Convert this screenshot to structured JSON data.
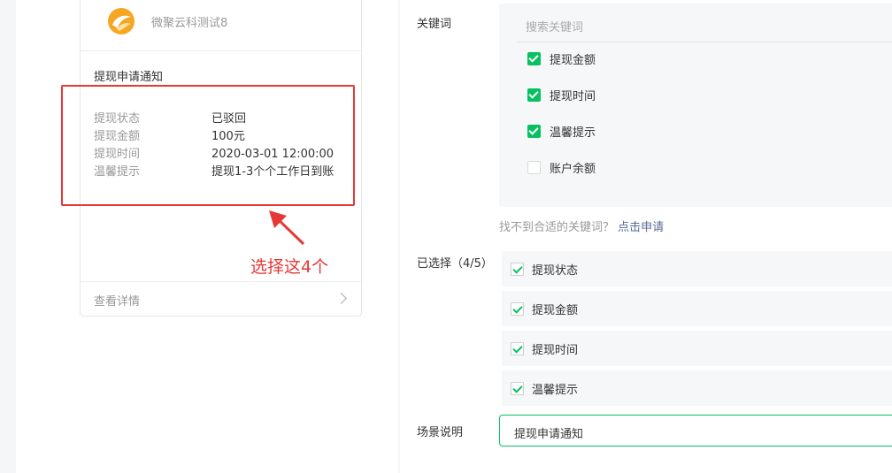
{
  "preview": {
    "account_name": "微聚云科测试8",
    "card_title": "提现申请通知",
    "fields": [
      {
        "key": "提现状态",
        "value": "已驳回"
      },
      {
        "key": "提现金额",
        "value": "100元"
      },
      {
        "key": "提现时间",
        "value": "2020-03-01 12:00:00"
      },
      {
        "key": "温馨提示",
        "value": "提现1-3个个工作日到账"
      }
    ],
    "detail_label": "查看详情"
  },
  "annotation": {
    "text": "选择这4个",
    "color": "#e53935"
  },
  "form": {
    "keywords_label": "关键词",
    "search_placeholder": "搜索关键词",
    "keywords": [
      {
        "label": "提现金额",
        "checked": true
      },
      {
        "label": "提现时间",
        "checked": true
      },
      {
        "label": "温馨提示",
        "checked": true
      },
      {
        "label": "账户余额",
        "checked": false
      }
    ],
    "hint_text": "找不到合适的关键词？",
    "hint_link": "点击申请",
    "selected_label": "已选择（4/5）",
    "selected": [
      "提现状态",
      "提现金额",
      "提现时间",
      "温馨提示"
    ],
    "scene_label": "场景说明",
    "scene_value": "提现申请通知"
  },
  "colors": {
    "accent": "#07c160",
    "link": "#576b95",
    "annotation": "#e53935"
  }
}
